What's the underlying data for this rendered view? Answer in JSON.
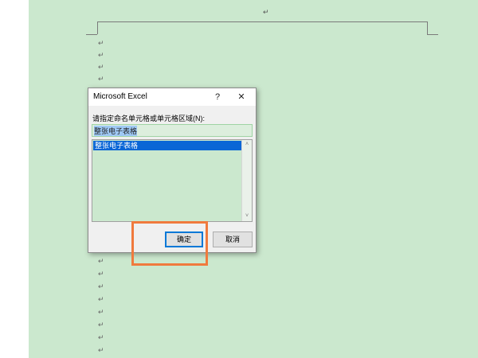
{
  "document": {
    "paragraph_mark": "↵"
  },
  "dialog": {
    "title": "Microsoft Excel",
    "help_label": "?",
    "close_label": "✕",
    "prompt": "请指定命名单元格或单元格区域(N):",
    "input_value": "整张电子表格",
    "list_items": [
      "整张电子表格"
    ],
    "ok_label": "确定",
    "cancel_label": "取消",
    "scroll_up": "˄",
    "scroll_down": "˅"
  },
  "colors": {
    "page_background": "#cbe8ce",
    "selection": "#0a66d6",
    "highlight_box": "#f07a3d"
  }
}
